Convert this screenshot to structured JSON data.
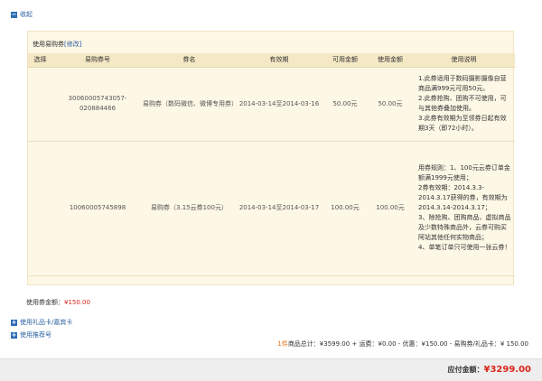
{
  "collapse": {
    "icon": "minus-icon",
    "label": "收起"
  },
  "coupon_panel": {
    "title": "使用易购券",
    "edit_label": "[修改]",
    "headers": [
      "选择",
      "易购券号",
      "券名",
      "有效期",
      "可用金额",
      "使用金额",
      "使用说明"
    ],
    "rows": [
      {
        "number": "30060005743057-020884466",
        "name": "易购券（数码微信、微博专用券）",
        "validity": "2014-03-14至2014-03-16",
        "available": "50.00元",
        "used": "50.00元",
        "desc": [
          "1.此券适用于数码摄影摄像自营商品满999元可用50元。",
          "2.此券抢购、团购不可使用，可与其他券叠加使用。",
          "3.此券有效期为至领券日起有效期3天（即72小时）。"
        ]
      },
      {
        "number": "10060005745898",
        "name": "易购券（3.15云券100元）",
        "validity": "2014-03-14至2014-03-17",
        "available": "100.00元",
        "used": "100.00元",
        "desc": [
          "用券规则：1、100元云券订单金额满1999元使用；",
          "2券有效期：2014.3.3-2014.3.17获得的券，有效期为2014.3.14-2014.3.17；",
          "3、除抢购、团购商品、虚拟商品及少数特殊商品外，云券可购买阿站其他任何实物商品；",
          "4、单笔订单只可使用一张云券！"
        ]
      }
    ]
  },
  "used_amount": {
    "label": "使用券金额：",
    "value": "¥150.00"
  },
  "gift_card": {
    "icon": "plus-icon",
    "label": "使用礼品卡/嘉宾卡"
  },
  "referrer": {
    "icon": "plus-icon",
    "label": "使用推荐号"
  },
  "summary": {
    "count": "1件",
    "text": "商品总计：¥3599.00 + 运费：¥0.00 - 优惠：¥150.00 - 易购券/礼品卡：¥ 150.00"
  },
  "payable": {
    "label": "应付金额：",
    "value": "¥3299.00"
  },
  "colors": {
    "link": "#2a5f9e",
    "price_red": "#d8261b",
    "count_orange": "#e36c09",
    "panel_bg": "#fdf7e6"
  }
}
